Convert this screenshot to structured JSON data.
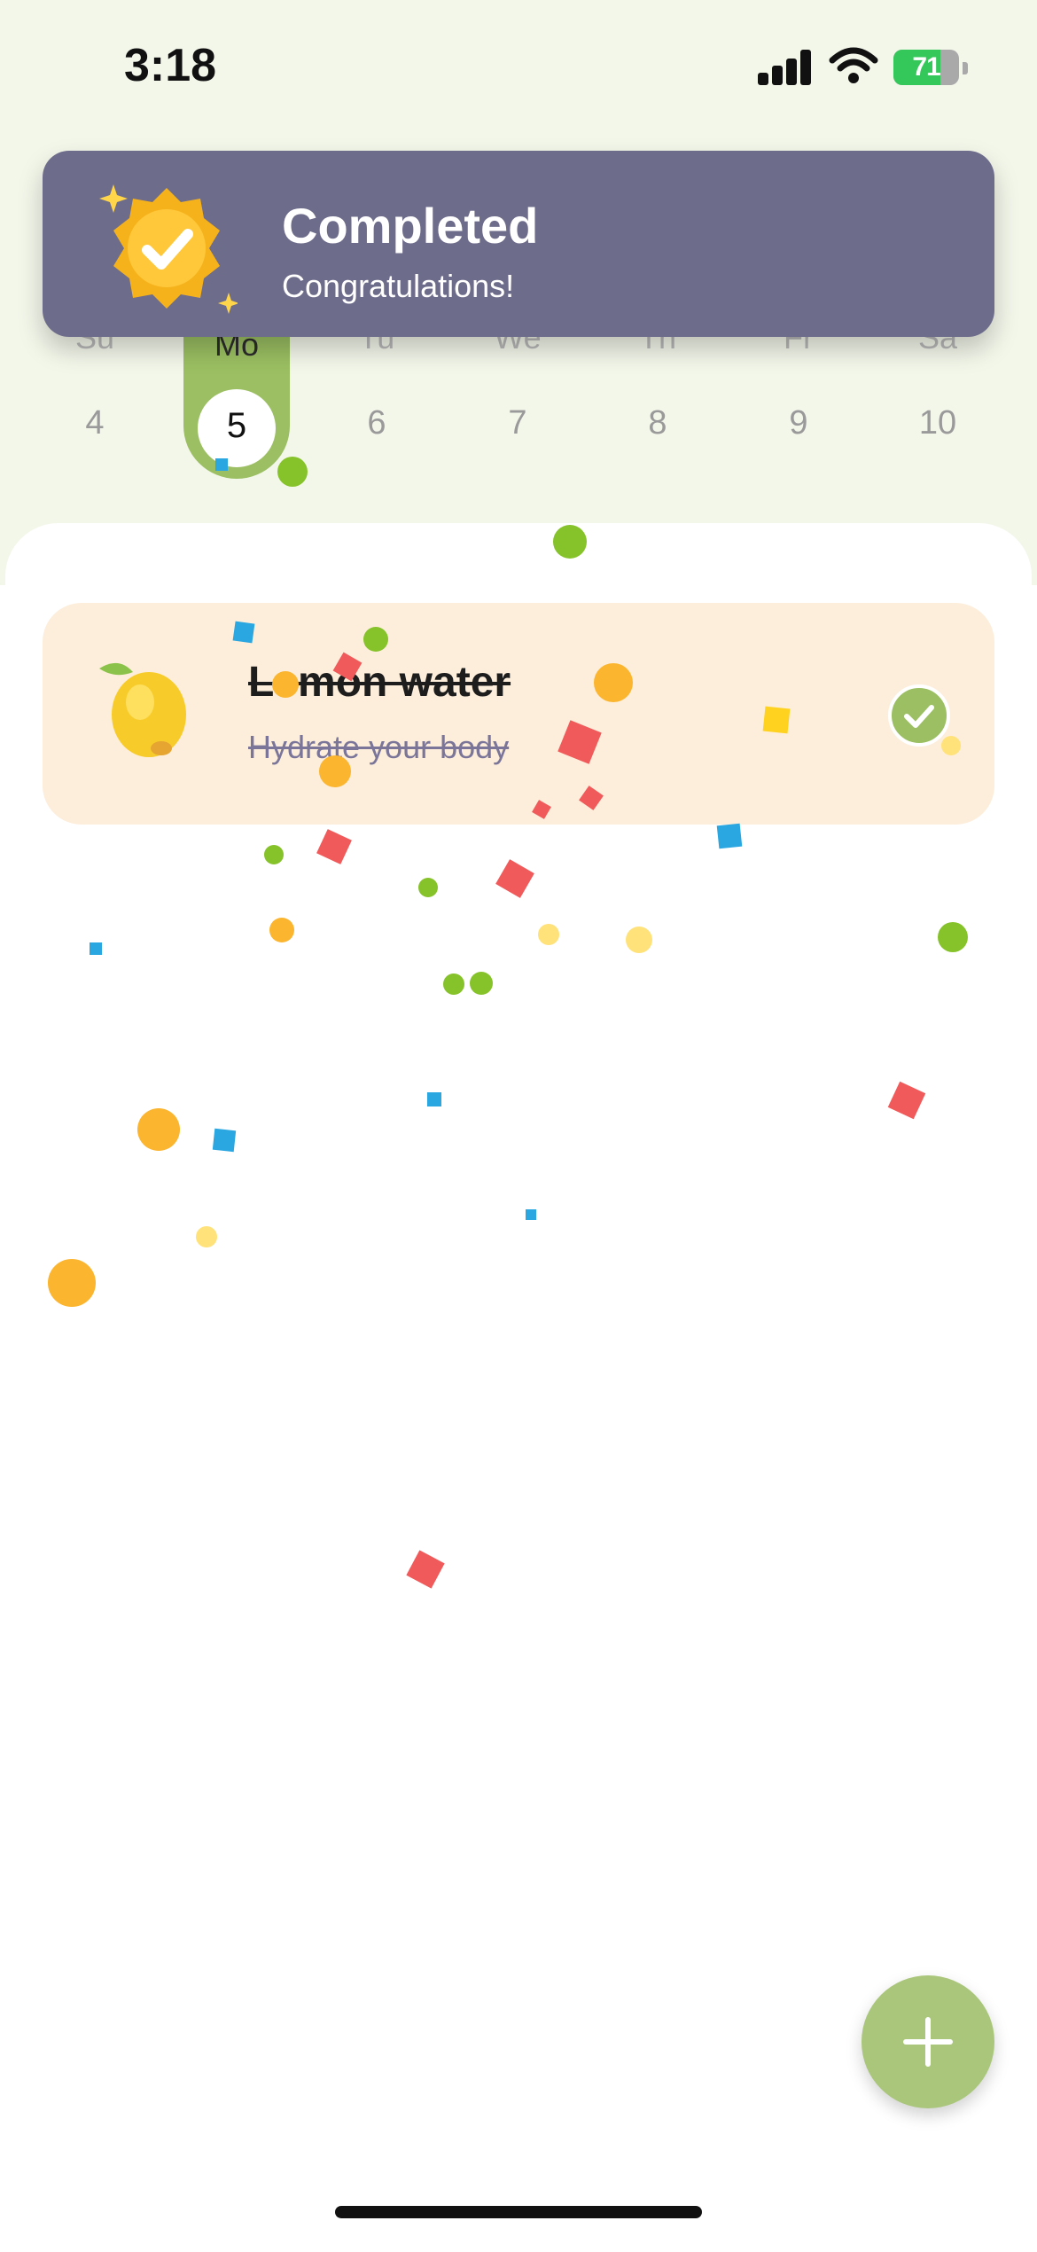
{
  "status_bar": {
    "time": "3:18",
    "battery": "71",
    "battery_level": 0.71
  },
  "notification": {
    "title": "Completed",
    "subtitle": "Congratulations!",
    "icon": "medal-check-icon"
  },
  "week": {
    "days": [
      {
        "name": "Su",
        "date": "4"
      },
      {
        "name": "Mo",
        "date": "5"
      },
      {
        "name": "Tu",
        "date": "6"
      },
      {
        "name": "We",
        "date": "7"
      },
      {
        "name": "Th",
        "date": "8"
      },
      {
        "name": "Fr",
        "date": "9"
      },
      {
        "name": "Sa",
        "date": "10"
      }
    ],
    "selected_index": 1
  },
  "habit": {
    "title": "Lemon water",
    "subtitle": "Hydrate your body",
    "icon": "lemon-icon",
    "completed": true
  },
  "fab": {
    "icon": "plus-icon"
  },
  "colors": {
    "accent": "#9bbf62",
    "toast": "#6e6c8b",
    "card": "#fdeedb",
    "top_bg": "#f3f7ea"
  }
}
